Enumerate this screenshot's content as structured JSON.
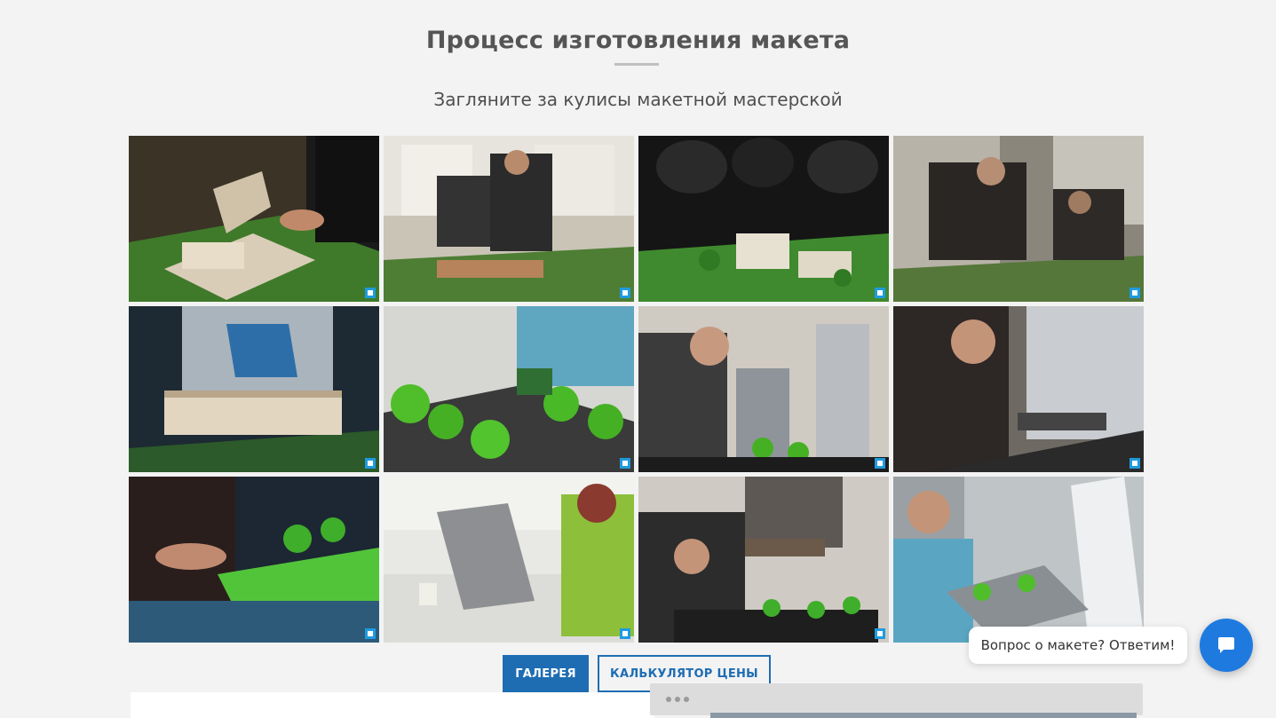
{
  "section": {
    "title": "Процесс изготовления макета",
    "subtitle": "Загляните за кулисы макетной мастерской"
  },
  "gallery": {
    "photos": [
      {
        "name": "photo-1",
        "alt": ""
      },
      {
        "name": "photo-2",
        "alt": ""
      },
      {
        "name": "photo-3",
        "alt": ""
      },
      {
        "name": "photo-4",
        "alt": ""
      },
      {
        "name": "photo-5",
        "alt": ""
      },
      {
        "name": "photo-6",
        "alt": ""
      },
      {
        "name": "photo-7",
        "alt": ""
      },
      {
        "name": "photo-8",
        "alt": ""
      },
      {
        "name": "photo-9",
        "alt": ""
      },
      {
        "name": "photo-10",
        "alt": ""
      },
      {
        "name": "photo-11",
        "alt": ""
      },
      {
        "name": "photo-12",
        "alt": ""
      }
    ]
  },
  "buttons": {
    "gallery_label": "ГАЛЕРЕЯ",
    "calculator_label": "КАЛЬКУЛЯТОР ЦЕНЫ"
  },
  "chat": {
    "prompt": "Вопрос о макете? Ответим!",
    "icon": "chat-bubble-icon"
  },
  "colors": {
    "accent": "#1e6db3",
    "chat_button": "#1f7ae0",
    "background": "#f3f3f3"
  }
}
